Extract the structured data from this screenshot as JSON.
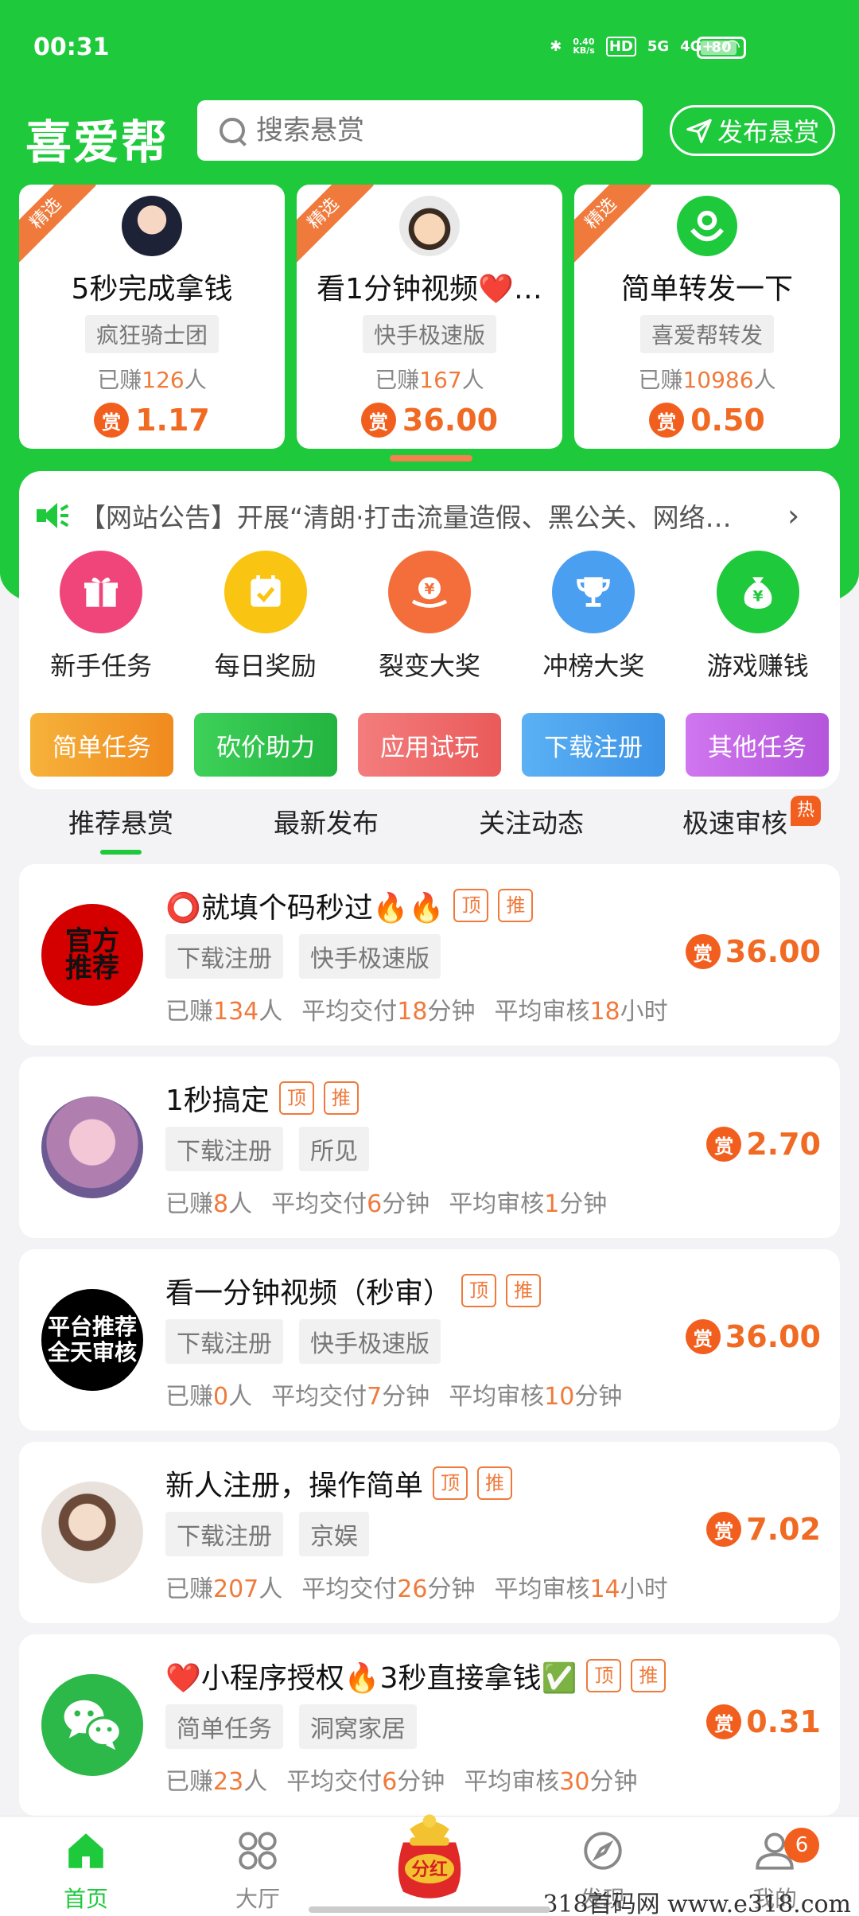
{
  "status": {
    "time": "00:31",
    "net_speed": "0.40\nKB/s",
    "hd": "HD",
    "sig1": "5G",
    "sig2": "4G+",
    "battery": "80"
  },
  "header": {
    "logo": "喜爱帮",
    "search_placeholder": "搜索悬赏",
    "publish_label": "发布悬赏"
  },
  "featured": [
    {
      "ribbon": "精选",
      "title": "5秒完成拿钱",
      "tag": "疯狂骑士团",
      "earned_prefix": "已赚",
      "earned_num": "126",
      "earned_suffix": "人",
      "reward_icon": "赏",
      "reward": "1.17"
    },
    {
      "ribbon": "精选",
      "title": "看1分钟视频❤️…",
      "tag": "快手极速版",
      "earned_prefix": "已赚",
      "earned_num": "167",
      "earned_suffix": "人",
      "reward_icon": "赏",
      "reward": "36.00"
    },
    {
      "ribbon": "精选",
      "title": "简单转发一下",
      "tag": "喜爱帮转发",
      "earned_prefix": "已赚",
      "earned_num": "10986",
      "earned_suffix": "人",
      "reward_icon": "赏",
      "reward": "0.50"
    }
  ],
  "notice": {
    "text": "【网站公告】开展“清朗·打击流量造假、黑公关、网络…",
    "chev": "›"
  },
  "icons": [
    {
      "label": "新手任务",
      "color": "#f0457a",
      "glyph": "🎁"
    },
    {
      "label": "每日奖励",
      "color": "#f9c512",
      "glyph": "✓"
    },
    {
      "label": "裂变大奖",
      "color": "#f36e3a",
      "glyph": "¥"
    },
    {
      "label": "冲榜大奖",
      "color": "#4b9ff0",
      "glyph": "🏆"
    },
    {
      "label": "游戏赚钱",
      "color": "#1fc93c",
      "glyph": "¥"
    }
  ],
  "categories": [
    {
      "label": "简单任务",
      "color": "#f4a12c"
    },
    {
      "label": "砍价助力",
      "color": "#30c450"
    },
    {
      "label": "应用试玩",
      "color": "#f06a6a"
    },
    {
      "label": "下载注册",
      "color": "#4aa2ee"
    },
    {
      "label": "其他任务",
      "color": "#c065e6"
    }
  ],
  "tabs": [
    "推荐悬赏",
    "最新发布",
    "关注动态",
    "极速审核"
  ],
  "hot_badge": "热",
  "badges": {
    "top": "顶",
    "rec": "推"
  },
  "tasks": [
    {
      "avatar_text": "官方\n推荐",
      "avatar_bg": "#d40000",
      "title": "⭕就填个码秒过🔥🔥",
      "tags": [
        "下载注册",
        "快手极速版"
      ],
      "earned": "134",
      "deliver": "18",
      "deliver_unit": "分钟",
      "review": "18",
      "review_unit": "小时",
      "reward": "36.00"
    },
    {
      "avatar_text": "",
      "avatar_bg": "#8d7bb0",
      "title": "1秒搞定",
      "tags": [
        "下载注册",
        "所见"
      ],
      "earned": "8",
      "deliver": "6",
      "deliver_unit": "分钟",
      "review": "1",
      "review_unit": "分钟",
      "reward": "2.70"
    },
    {
      "avatar_text": "平台推荐\n全天审核",
      "avatar_bg": "#000000",
      "title": "看一分钟视频（秒审）",
      "tags": [
        "下载注册",
        "快手极速版"
      ],
      "earned": "0",
      "deliver": "7",
      "deliver_unit": "分钟",
      "review": "10",
      "review_unit": "分钟",
      "reward": "36.00"
    },
    {
      "avatar_text": "",
      "avatar_bg": "#c9a592",
      "title": "新人注册，操作简单",
      "tags": [
        "下载注册",
        "京娱"
      ],
      "earned": "207",
      "deliver": "26",
      "deliver_unit": "分钟",
      "review": "14",
      "review_unit": "小时",
      "reward": "7.02"
    },
    {
      "avatar_text": "",
      "avatar_bg": "#2db84a",
      "title": "❤️小程序授权🔥3秒直接拿钱✅",
      "tags": [
        "简单任务",
        "洞窝家居"
      ],
      "earned": "23",
      "deliver": "6",
      "deliver_unit": "分钟",
      "review": "30",
      "review_unit": "分钟",
      "reward": "0.31"
    }
  ],
  "stat_labels": {
    "earned_prefix": "已赚",
    "earned_suffix": "人",
    "deliver_prefix": "平均交付",
    "review_prefix": "平均审核"
  },
  "nav": [
    {
      "label": "首页"
    },
    {
      "label": "大厅"
    },
    {
      "label": "分红"
    },
    {
      "label": "发现"
    },
    {
      "label": "我的",
      "badge": "6"
    }
  ],
  "watermark": "318首码网 www.e318.com"
}
